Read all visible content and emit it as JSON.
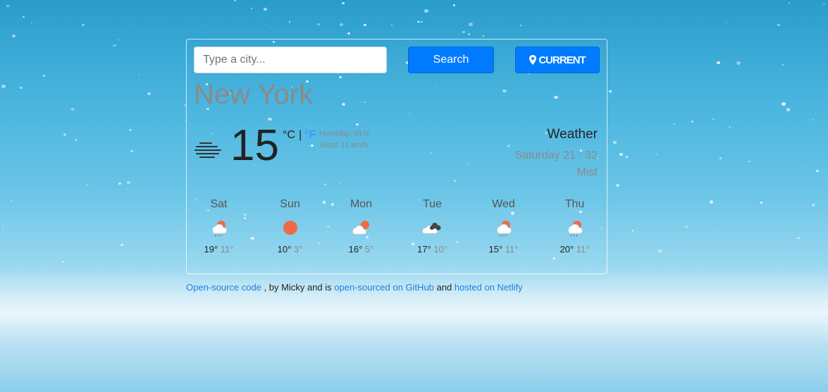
{
  "search": {
    "placeholder": "Type a city...",
    "button_label": "Search"
  },
  "current_button": {
    "label": "CURRENT"
  },
  "weather": {
    "city": "New York",
    "temperature": "15",
    "unit_c": "°C",
    "unit_sep": "|",
    "unit_f": "°F",
    "humidity": "Humidity: 91%",
    "wind": "Wind: 11 km/h",
    "heading": "Weather",
    "date": "Saturday 21 : 32",
    "description": "Mist",
    "icon": "mist-icon"
  },
  "forecast": [
    {
      "day": "Sat",
      "max": "19°",
      "min": "11°",
      "icon": "rain-sun-icon"
    },
    {
      "day": "Sun",
      "max": "10°",
      "min": "3°",
      "icon": "sun-icon"
    },
    {
      "day": "Mon",
      "max": "16°",
      "min": "5°",
      "icon": "partly-cloudy-icon"
    },
    {
      "day": "Tue",
      "max": "17°",
      "min": "10°",
      "icon": "cloudy-icon"
    },
    {
      "day": "Wed",
      "max": "15°",
      "min": "11°",
      "icon": "rain-sun-icon"
    },
    {
      "day": "Thu",
      "max": "20°",
      "min": "11°",
      "icon": "rain-sun-icon"
    }
  ],
  "footer": {
    "link1": "Open-source code",
    "text1": " , by Micky and is ",
    "link2": "open-sourced on GitHub",
    "text2": " and ",
    "link3": "hosted on Netlify"
  },
  "colors": {
    "accent": "#007bff",
    "link": "#1f7fe0",
    "sun": "#f06a45"
  }
}
